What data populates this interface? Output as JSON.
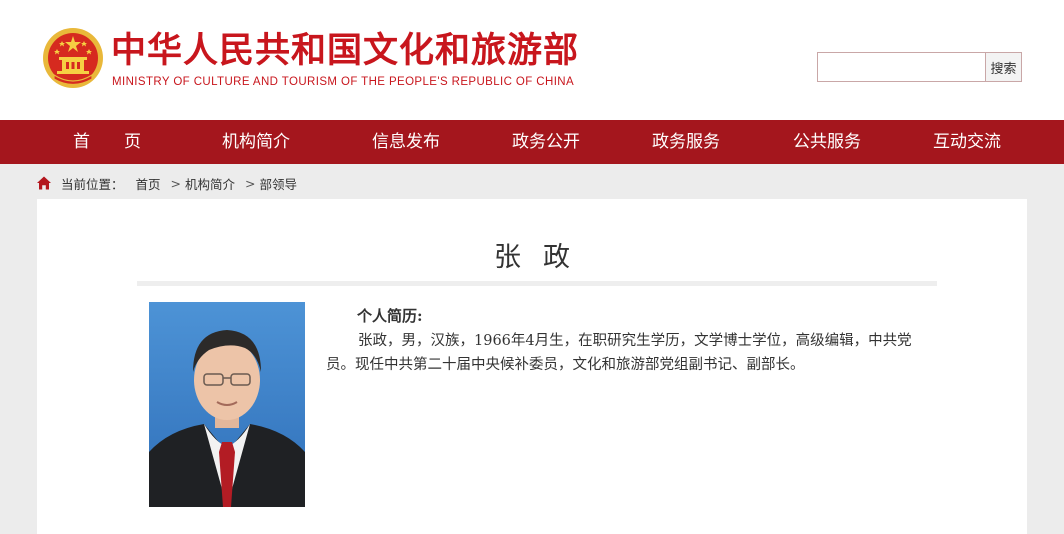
{
  "site": {
    "title": "中华人民共和国文化和旅游部",
    "subtitle": "MINISTRY OF CULTURE AND TOURISM OF THE PEOPLE'S REPUBLIC OF CHINA",
    "brand_color": "#c8161d",
    "emblem_icon": "national-emblem-icon"
  },
  "search": {
    "placeholder": "",
    "value": "",
    "button_label": "搜索"
  },
  "nav": {
    "background": "#a4161d",
    "items": [
      {
        "label": "首　　页"
      },
      {
        "label": "机构简介"
      },
      {
        "label": "信息发布"
      },
      {
        "label": "政务公开"
      },
      {
        "label": "政务服务"
      },
      {
        "label": "公共服务"
      },
      {
        "label": "互动交流"
      }
    ]
  },
  "breadcrumb": {
    "icon": "home-icon",
    "prefix": "当前位置：",
    "items": [
      {
        "label": "首页"
      },
      {
        "label": "机构简介"
      },
      {
        "label": "部领导"
      }
    ],
    "separator": ">"
  },
  "profile": {
    "name": "张政",
    "bio_heading": "个人简历:",
    "bio_text": "张政，男，汉族，1966年4月生，在职研究生学历，文学博士学位，高级编辑，中共党员。现任中共第二十届中央候补委员，文化和旅游部党组副书记、副部长。"
  }
}
